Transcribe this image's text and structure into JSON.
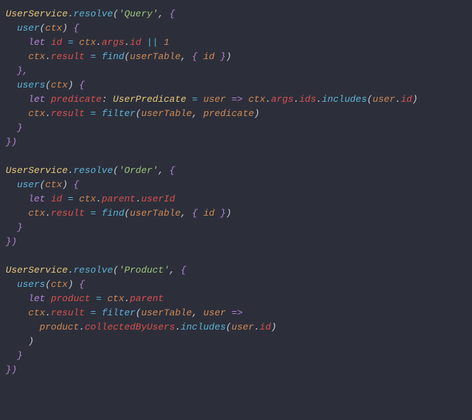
{
  "tokens": {
    "UserService": "UserService",
    "resolve": "resolve",
    "Query": "'Query'",
    "Order": "'Order'",
    "Product": "'Product'",
    "user": "user",
    "users": "users",
    "ctx": "ctx",
    "let": "let",
    "id": "id",
    "predicate": "predicate",
    "product": "product",
    "UserPredicate": "UserPredicate",
    "args": "args",
    "ids": "ids",
    "result": "result",
    "parent": "parent",
    "userId": "userId",
    "collectedByUsers": "collectedByUsers",
    "includes": "includes",
    "find": "find",
    "filter": "filter",
    "userTable": "userTable",
    "one": "1",
    "arrow": "=>",
    "or": "||",
    "eq": "=",
    "dot": ".",
    "comma": ",",
    "colon": ":",
    "lparen": "(",
    "rparen": ")",
    "lbrace": "{",
    "rbrace": "}",
    "rbrace_rparen": "})",
    "rbrace_comma": "},",
    "space": " "
  }
}
